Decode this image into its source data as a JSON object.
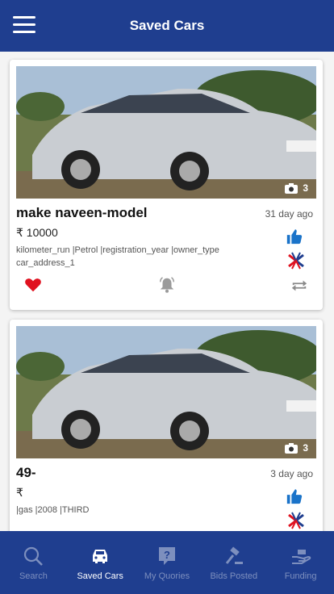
{
  "header": {
    "title": "Saved Cars",
    "menu_icon": "hamburger-menu-icon"
  },
  "colors": {
    "header_bg": "#1f3e8f",
    "heart": "#e0111f",
    "like": "#1a73c9",
    "tab_inactive": "#7d8fbe"
  },
  "cars": [
    {
      "name": "make naveen-model",
      "price": "₹ 10000",
      "specs_line1": "kilometer_run |Petrol |registration_year |owner_type",
      "specs_line2": "car_address_1",
      "ago": "31 day ago",
      "photo_count": "3"
    },
    {
      "name": "49-",
      "price": "₹",
      "specs_line1": " |gas |2008 |THIRD",
      "specs_line2": "",
      "ago": "3 day ago",
      "photo_count": "3"
    }
  ],
  "tabs": [
    {
      "label": "Search",
      "icon": "search-icon",
      "active": false
    },
    {
      "label": "Saved Cars",
      "icon": "car-icon",
      "active": true
    },
    {
      "label": "My Quories",
      "icon": "question-icon",
      "active": false
    },
    {
      "label": "Bids Posted",
      "icon": "gavel-icon",
      "active": false
    },
    {
      "label": "Funding",
      "icon": "funding-hand-icon",
      "active": false
    }
  ]
}
